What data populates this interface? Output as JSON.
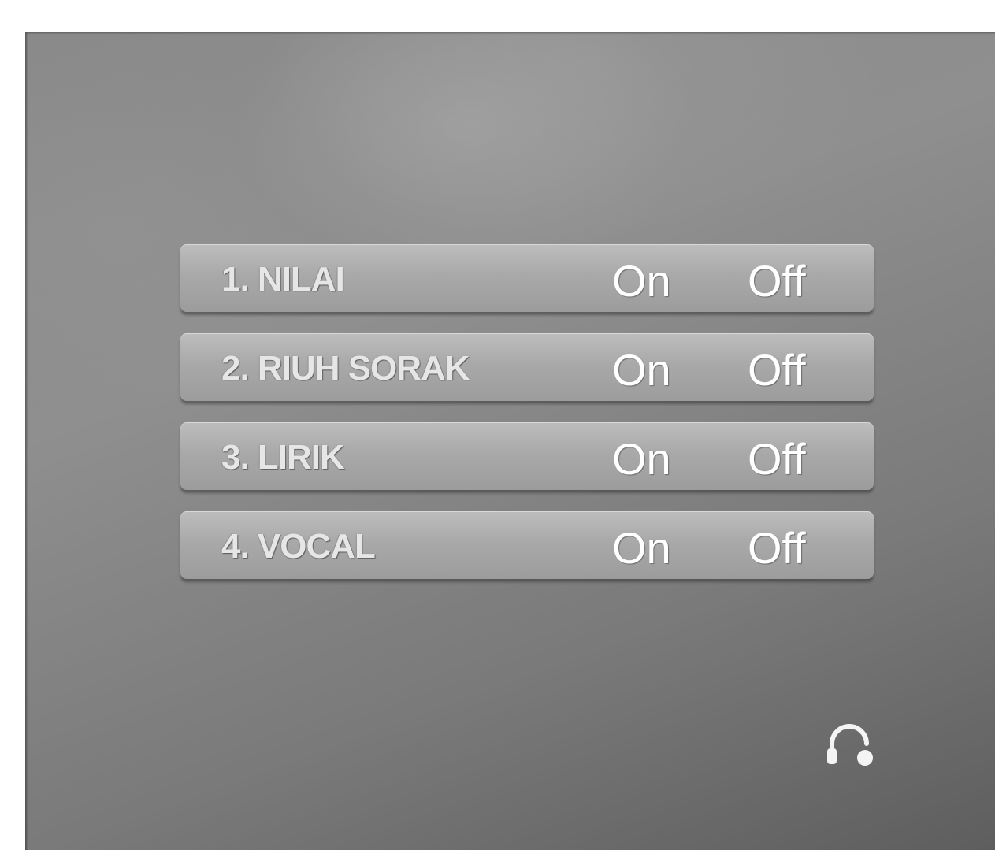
{
  "menu": {
    "items": [
      {
        "label": "1. NILAI",
        "on_label": "On",
        "off_label": "Off"
      },
      {
        "label": "2. RIUH SORAK",
        "on_label": "On",
        "off_label": "Off"
      },
      {
        "label": "3. LIRIK",
        "on_label": "On",
        "off_label": "Off"
      },
      {
        "label": "4. VOCAL",
        "on_label": "On",
        "off_label": "Off"
      }
    ]
  },
  "status": {
    "icon": "headphone-icon"
  },
  "colors": {
    "text": "#ffffff",
    "panel": "#8a8a8a",
    "row": "#a9a9a9"
  }
}
